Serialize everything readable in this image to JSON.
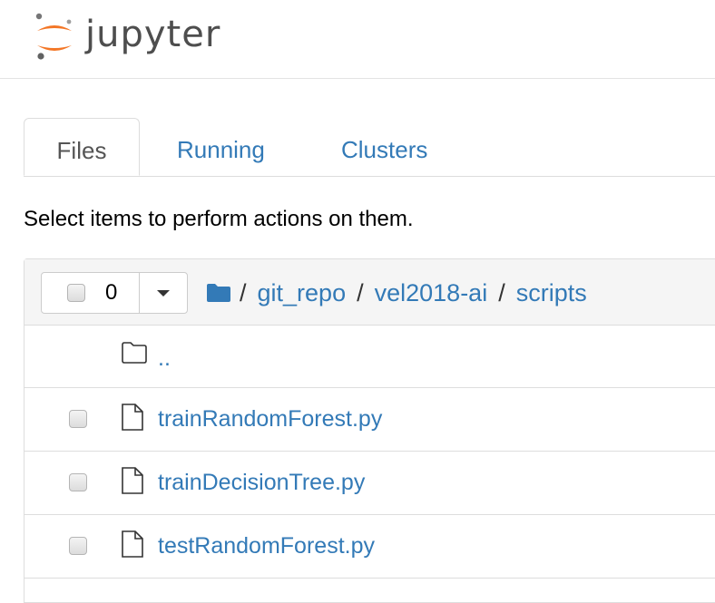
{
  "app": {
    "logo_text": "jupyter",
    "accent": "#f37626",
    "link_color": "#337ab7"
  },
  "tabs": [
    {
      "label": "Files",
      "active": true
    },
    {
      "label": "Running",
      "active": false
    },
    {
      "label": "Clusters",
      "active": false
    }
  ],
  "instructions": "Select items to perform actions on them.",
  "selector": {
    "count": "0"
  },
  "breadcrumb": {
    "root_icon": "folder-icon",
    "separator": "/",
    "parts": [
      "git_repo",
      "vel2018-ai",
      "scripts"
    ]
  },
  "parent_dir": {
    "icon": "folder-outline-icon",
    "label": ".."
  },
  "files": [
    {
      "name": "trainRandomForest.py",
      "icon": "file-icon"
    },
    {
      "name": "trainDecisionTree.py",
      "icon": "file-icon"
    },
    {
      "name": "testRandomForest.py",
      "icon": "file-icon"
    }
  ]
}
